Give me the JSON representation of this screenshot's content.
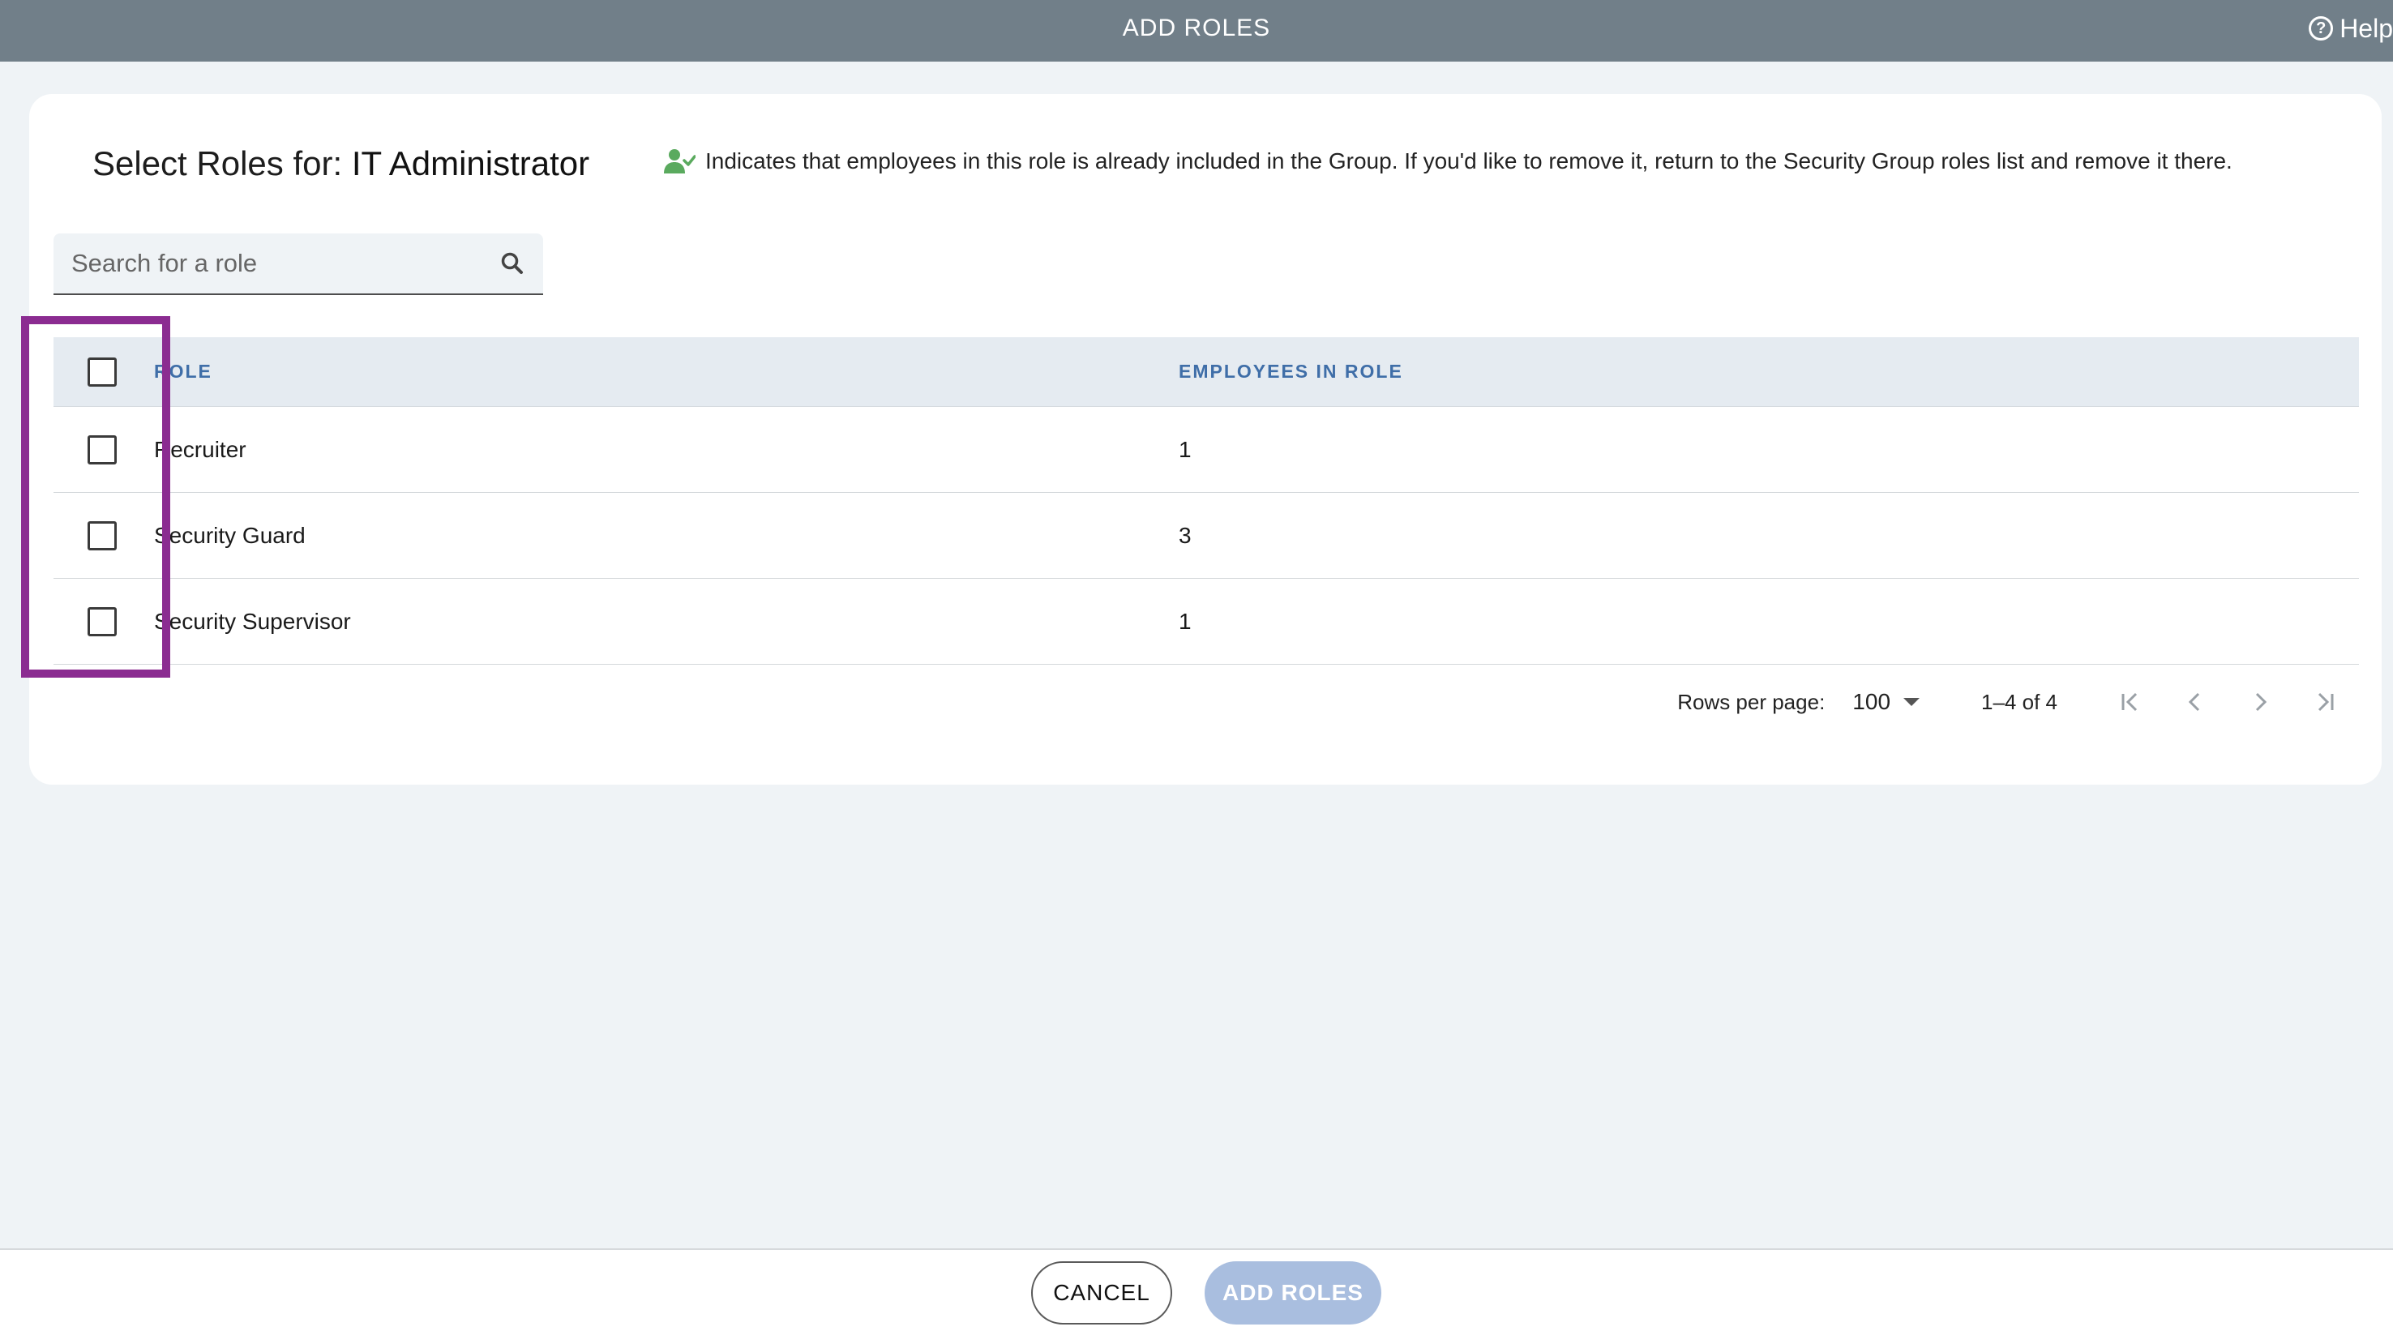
{
  "header": {
    "title": "ADD ROLES",
    "help_label": "Help"
  },
  "card": {
    "heading_prefix": "Select Roles for:",
    "group_name": "IT Administrator",
    "note_text": "Indicates that employees in this role is already included in the Group. If you'd like to remove it, return to the Security Group roles list and remove it there."
  },
  "search": {
    "placeholder": "Search for a role"
  },
  "table": {
    "columns": [
      "ROLE",
      "EMPLOYEES IN ROLE"
    ],
    "rows": [
      {
        "role": "Recruiter",
        "employees": "1"
      },
      {
        "role": "Security Guard",
        "employees": "3"
      },
      {
        "role": "Security Supervisor",
        "employees": "1"
      }
    ]
  },
  "pagination": {
    "rows_per_page_label": "Rows per page:",
    "rows_per_page_value": "100",
    "range": "1–4 of 4"
  },
  "footer": {
    "cancel_label": "CANCEL",
    "add_label": "ADD ROLES"
  },
  "colors": {
    "topbar": "#717f89",
    "accent_header": "#3f6ea8",
    "highlight": "#8b2c91",
    "add_button": "#a9bedf",
    "included_icon": "#5aaa5e"
  }
}
